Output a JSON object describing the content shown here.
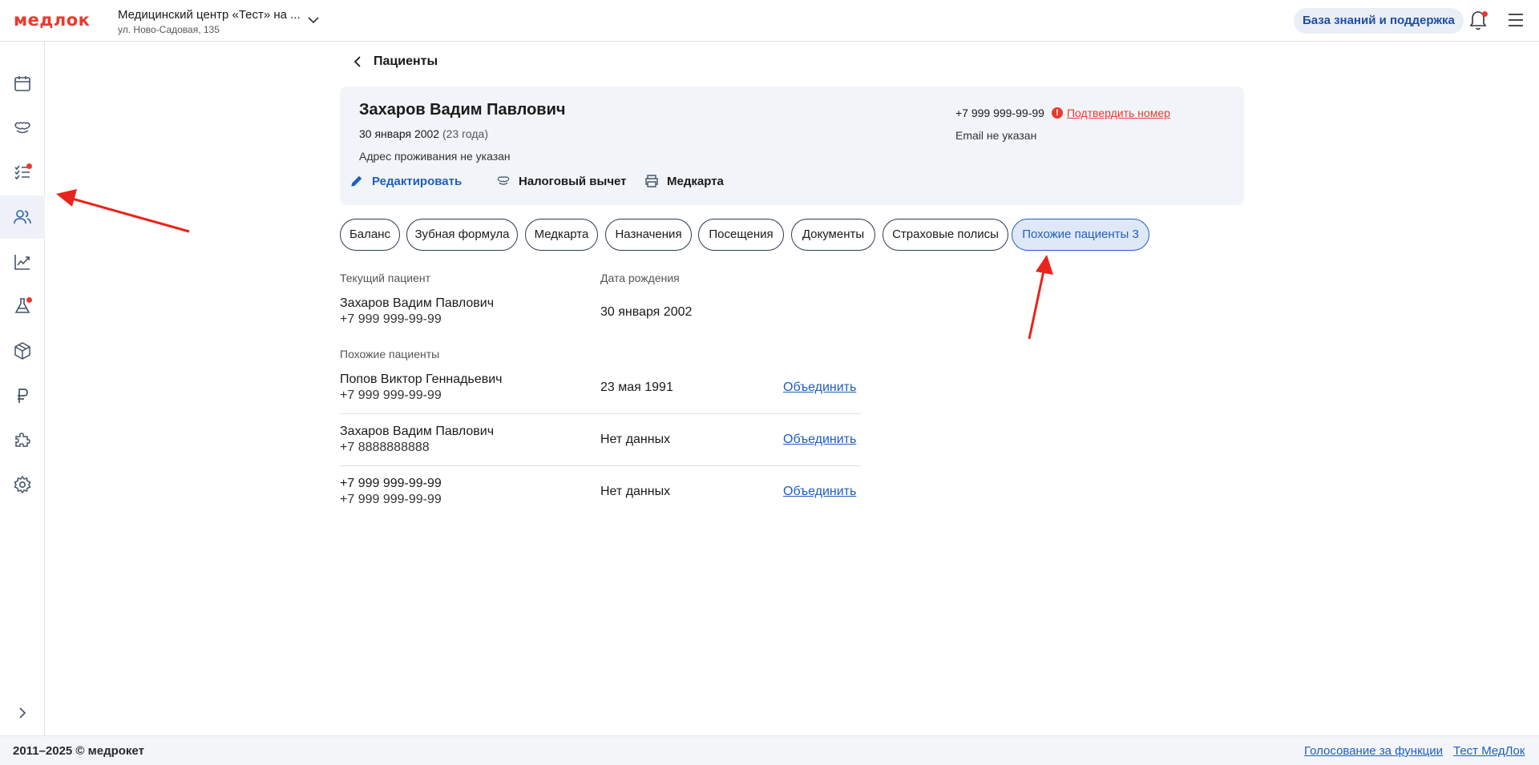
{
  "header": {
    "logo": "медлок",
    "clinic_name": "Медицинский центр «Тест» на ...",
    "clinic_address": "ул. Ново-Садовая, 135",
    "kb_button": "База знаний и поддержка"
  },
  "sidebar": {
    "items": [
      {
        "icon": "calendar-icon",
        "active": false,
        "badge": false
      },
      {
        "icon": "tooth-icon",
        "active": false,
        "badge": false
      },
      {
        "icon": "tasks-icon",
        "active": false,
        "badge": true
      },
      {
        "icon": "patients-icon",
        "active": true,
        "badge": false
      },
      {
        "icon": "analytics-icon",
        "active": false,
        "badge": false
      },
      {
        "icon": "lab-flask-icon",
        "active": false,
        "badge": true
      },
      {
        "icon": "box-icon",
        "active": false,
        "badge": false
      },
      {
        "icon": "ruble-icon",
        "active": false,
        "badge": false
      },
      {
        "icon": "puzzle-icon",
        "active": false,
        "badge": false
      },
      {
        "icon": "settings-icon",
        "active": false,
        "badge": false
      }
    ]
  },
  "page": {
    "back_title": "Пациенты"
  },
  "patient": {
    "name": "Захаров Вадим Павлович",
    "dob": "30 января 2002",
    "age": "(23 года)",
    "address": "Адрес проживания не указан",
    "phone": "+7 999 999-99-99",
    "confirm_link": "Подтвердить номер",
    "email": "Email не указан",
    "actions": {
      "edit": "Редактировать",
      "tax": "Налоговый вычет",
      "medcard": "Медкарта"
    }
  },
  "tabs": [
    {
      "label": "Баланс",
      "active": false
    },
    {
      "label": "Зубная формула",
      "active": false
    },
    {
      "label": "Медкарта",
      "active": false
    },
    {
      "label": "Назначения",
      "active": false
    },
    {
      "label": "Посещения",
      "active": false
    },
    {
      "label": "Документы",
      "active": false
    },
    {
      "label": "Страховые полисы",
      "active": false
    },
    {
      "label": "Похожие пациенты 3",
      "active": true
    }
  ],
  "similar": {
    "current_label": "Текущий пациент",
    "dob_label": "Дата рождения",
    "current": {
      "name": "Захаров Вадим Павлович",
      "phone": "+7 999 999-99-99",
      "dob": "30 января 2002"
    },
    "similar_label": "Похожие пациенты",
    "rows": [
      {
        "name": "Попов Виктор Геннадьевич",
        "phone": "+7 999 999-99-99",
        "dob": "23 мая 1991",
        "action": "Объединить"
      },
      {
        "name": "Захаров Вадим Павлович",
        "phone": "+7 8888888888",
        "dob": "Нет данных",
        "action": "Объединить"
      },
      {
        "name": "+7 999 999-99-99",
        "phone": "+7 999 999-99-99",
        "dob": "Нет данных",
        "action": "Объединить"
      }
    ]
  },
  "footer": {
    "copyright": "2011–2025 © медрокет",
    "vote_link": "Голосование за функции",
    "test_link": "Тест МедЛок"
  },
  "colors": {
    "brand_red": "#e83a2e",
    "link_blue": "#1e5fbf",
    "card_bg": "#f1f4f9"
  }
}
